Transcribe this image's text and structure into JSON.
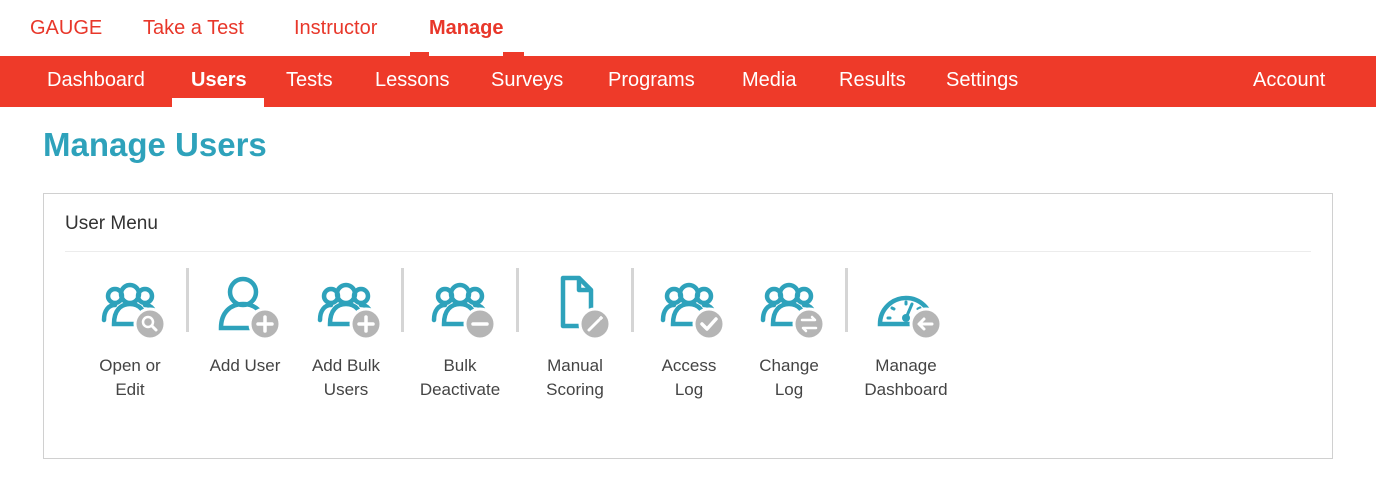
{
  "top_nav": {
    "items": [
      {
        "label": "GAUGE"
      },
      {
        "label": "Take a Test"
      },
      {
        "label": "Instructor"
      },
      {
        "label": "Manage"
      }
    ]
  },
  "main_nav": {
    "items": [
      {
        "label": "Dashboard"
      },
      {
        "label": "Users"
      },
      {
        "label": "Tests"
      },
      {
        "label": "Lessons"
      },
      {
        "label": "Surveys"
      },
      {
        "label": "Programs"
      },
      {
        "label": "Media"
      },
      {
        "label": "Results"
      },
      {
        "label": "Settings"
      }
    ],
    "account": "Account"
  },
  "page": {
    "title": "Manage Users"
  },
  "user_menu": {
    "title": "User Menu",
    "tools": [
      {
        "label": "Open or\nEdit",
        "icon": "users-search-icon"
      },
      {
        "label": "Add User",
        "icon": "user-add-icon"
      },
      {
        "label": "Add Bulk\nUsers",
        "icon": "users-add-icon"
      },
      {
        "label": "Bulk\nDeactivate",
        "icon": "users-remove-icon"
      },
      {
        "label": "Manual\nScoring",
        "icon": "document-wand-icon"
      },
      {
        "label": "Access\nLog",
        "icon": "users-check-icon"
      },
      {
        "label": "Change\nLog",
        "icon": "users-swap-icon"
      },
      {
        "label": "Manage\nDashboard",
        "icon": "dashboard-gauge-icon"
      }
    ]
  },
  "colors": {
    "brand_red": "#ee3a29",
    "accent_teal": "#2ea2bb",
    "badge_gray": "#b5b5b5"
  }
}
